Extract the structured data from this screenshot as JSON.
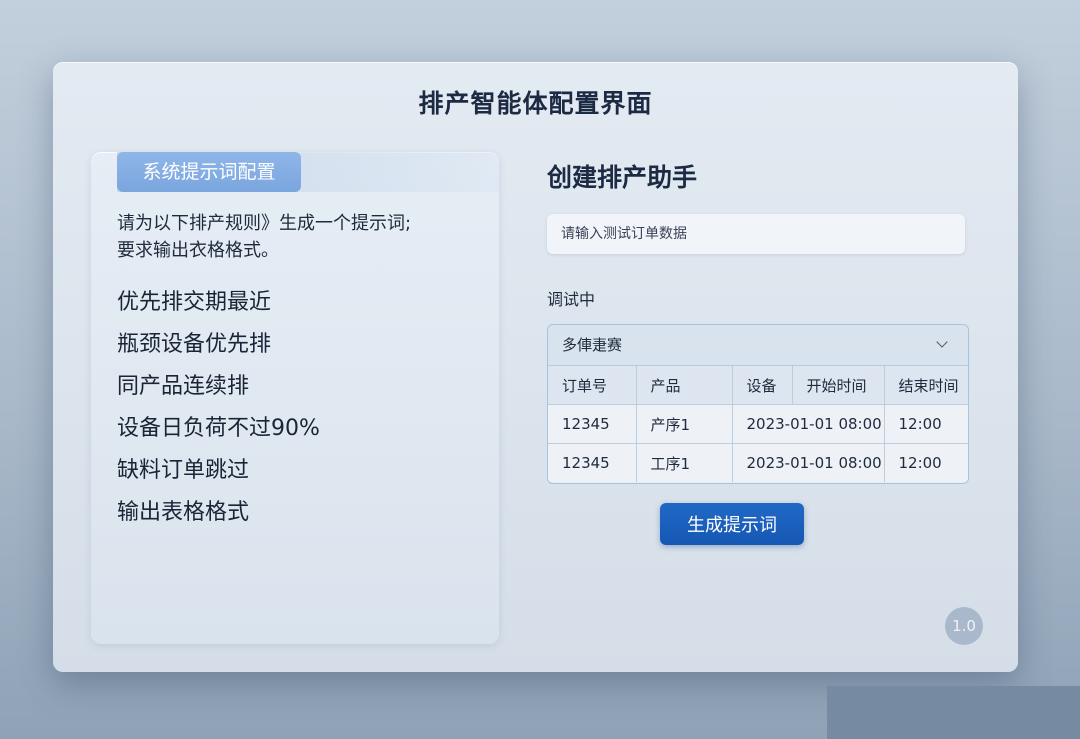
{
  "window": {
    "title": "排产智能体配置界面"
  },
  "left_panel": {
    "tab_label": "系统提示词配置",
    "instruction_line1": "请为以下排产规则》生成一个提示词;",
    "instruction_line2": "要求输出衣格格式。",
    "rules": [
      "优先排交期最近",
      "瓶颈设备优先排",
      "同产品连续排",
      "设备日负荷不过90%",
      "缺料订单跳过",
      "输出表格格式"
    ]
  },
  "right_panel": {
    "title": "创建排产助手",
    "input_placeholder": "请输入测试订单数据",
    "status": "调试中",
    "dropdown_value": "多俥疌赛",
    "table": {
      "headers": [
        "订单号",
        "产品",
        "设备",
        "开始时间",
        "结束时间"
      ],
      "rows": [
        [
          "12345",
          "产序1",
          "2023-01-01 08:00",
          "12:00"
        ],
        [
          "12345",
          "工序1",
          "2023-01-01 08:00",
          "12:00"
        ]
      ]
    },
    "generate_button": "生成提示词",
    "version": "1.0"
  },
  "colors": {
    "accent": "#1a5fbf",
    "tab": "#7ea9df",
    "background": "#a9b9ca"
  }
}
